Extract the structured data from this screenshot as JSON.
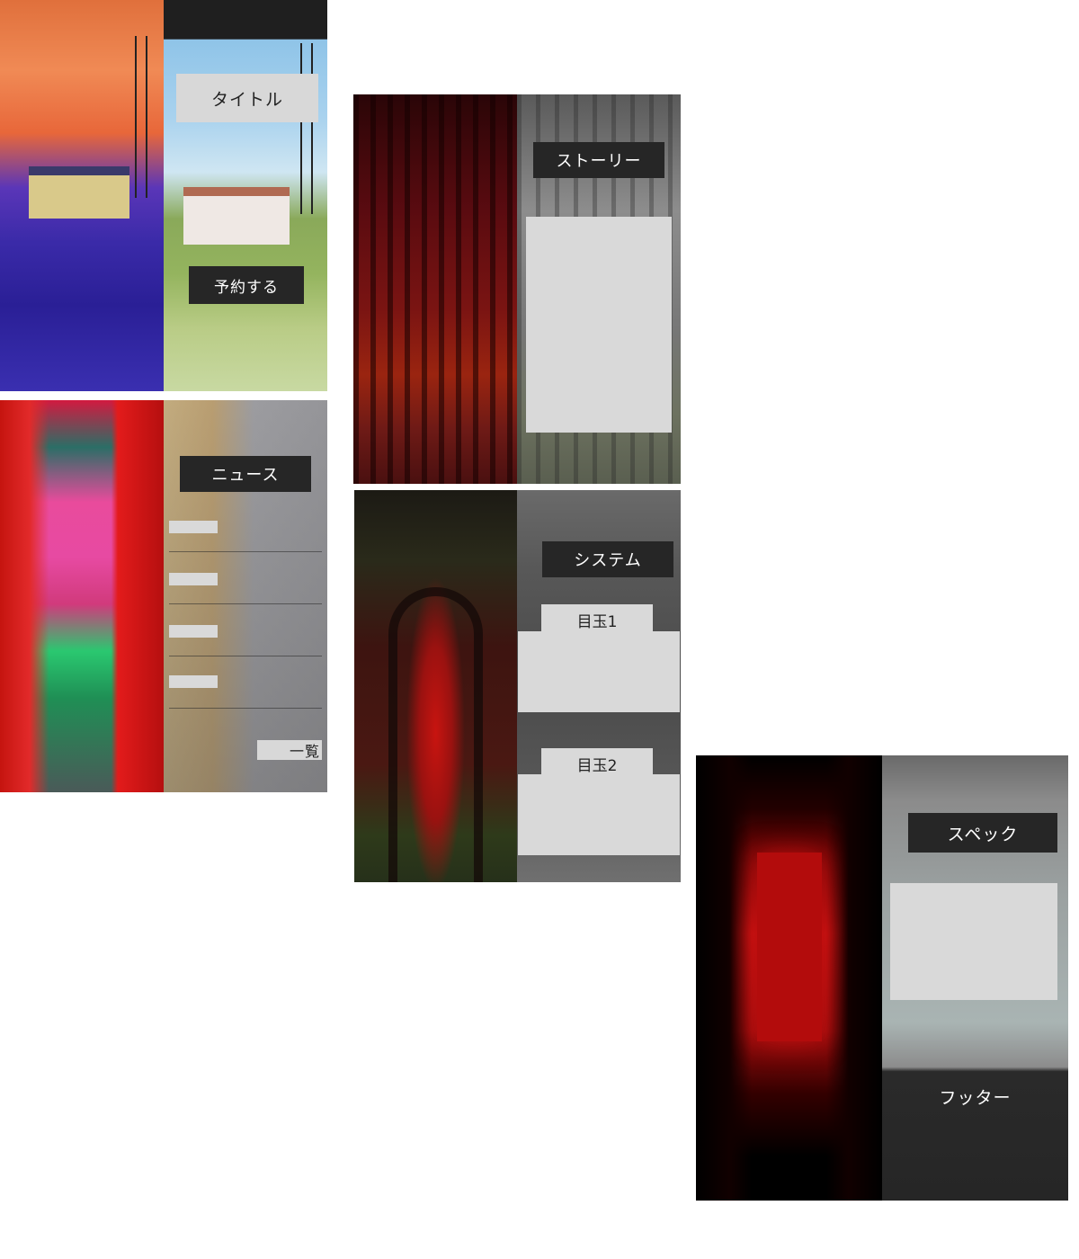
{
  "panels": {
    "title": {
      "heading": "タイトル",
      "cta": "予約する"
    },
    "news": {
      "heading": "ニュース",
      "more": "一覧"
    },
    "story": {
      "heading": "ストーリー"
    },
    "system": {
      "heading": "システム",
      "feature1": "目玉1",
      "feature2": "目玉2"
    },
    "spec": {
      "heading": "スペック",
      "footer": "フッター"
    }
  }
}
